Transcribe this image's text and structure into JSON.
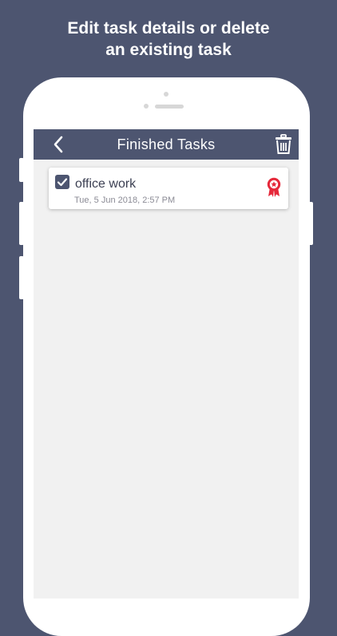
{
  "promo": {
    "line1": "Edit task details or delete",
    "line2": "an existing task"
  },
  "app_bar": {
    "title": "Finished Tasks",
    "back_icon": "chevron-left-icon",
    "delete_icon": "trash-icon"
  },
  "tasks": [
    {
      "title": "office work",
      "date": "Tue, 5 Jun 2018, 2:57 PM",
      "checked": true,
      "badge_icon": "award-ribbon-icon"
    }
  ],
  "colors": {
    "background": "#4d5570",
    "app_bar": "#4d5570",
    "screen_bg": "#f1f1f1",
    "accent_red": "#e5283a"
  }
}
